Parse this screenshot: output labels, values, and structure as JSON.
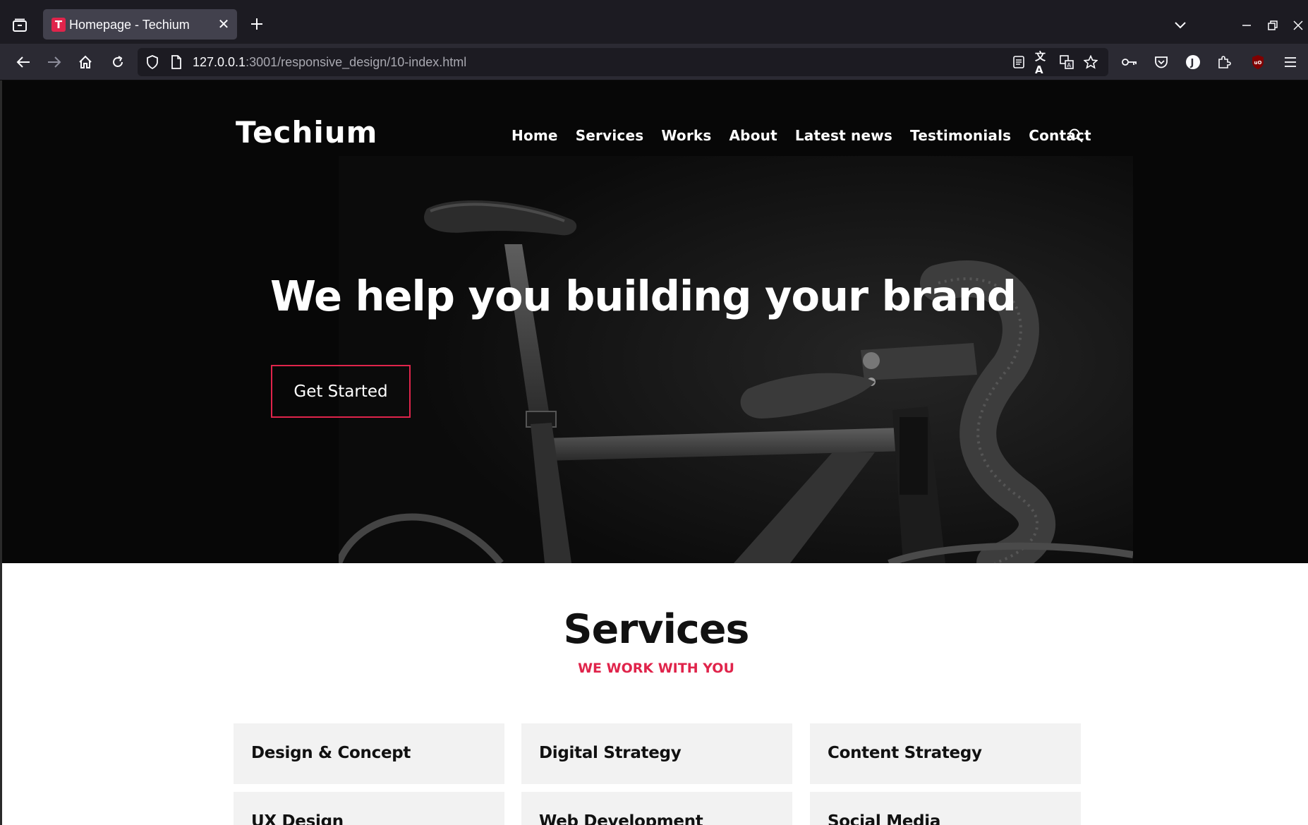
{
  "browser": {
    "tab_title": "Homepage - Techium",
    "tab_favicon_letter": "T",
    "url_host": "127.0.0.1",
    "url_rest": ":3001/responsive_design/10-index.html",
    "accent_color": "#e0244b"
  },
  "site": {
    "logo": "Techium",
    "nav": [
      "Home",
      "Services",
      "Works",
      "About",
      "Latest news",
      "Testimonials",
      "Contact"
    ],
    "hero_title": "We help you building your brand",
    "cta_label": "Get Started"
  },
  "services": {
    "title": "Services",
    "subtitle": "WE WORK WITH YOU",
    "cards": [
      "Design & Concept",
      "Digital Strategy",
      "Content Strategy",
      "UX Design",
      "Web Development",
      "Social Media"
    ]
  }
}
